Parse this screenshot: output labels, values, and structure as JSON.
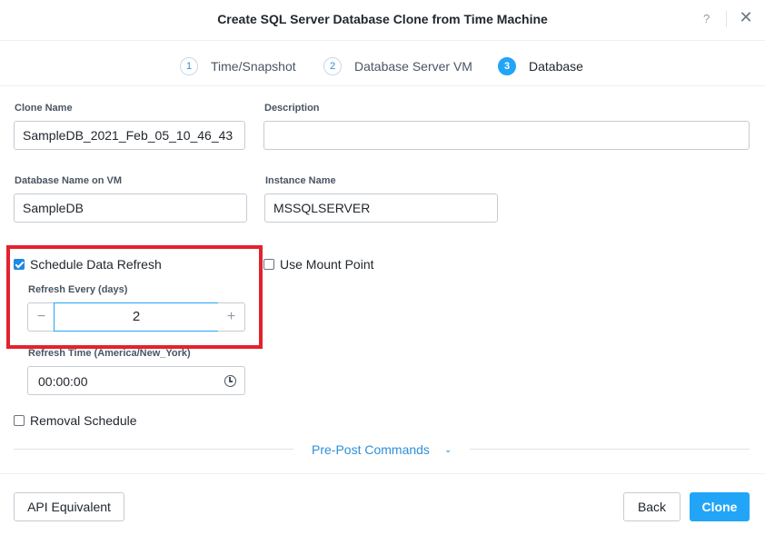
{
  "header": {
    "title": "Create SQL Server Database Clone from Time Machine",
    "help_label": "?",
    "close_label": "✕"
  },
  "wizard": {
    "steps": [
      {
        "number": "1",
        "label": "Time/Snapshot",
        "active": false
      },
      {
        "number": "2",
        "label": "Database Server VM",
        "active": false
      },
      {
        "number": "3",
        "label": "Database",
        "active": true
      }
    ]
  },
  "form": {
    "clone_name": {
      "label": "Clone Name",
      "value": "SampleDB_2021_Feb_05_10_46_43"
    },
    "description": {
      "label": "Description",
      "value": ""
    },
    "database_name": {
      "label": "Database Name on VM",
      "value": "SampleDB"
    },
    "instance_name": {
      "label": "Instance Name",
      "value": "MSSQLSERVER"
    },
    "schedule_refresh": {
      "label": "Schedule Data Refresh",
      "checked": true
    },
    "use_mount_point": {
      "label": "Use Mount Point",
      "checked": false
    },
    "refresh_every": {
      "label": "Refresh Every (days)",
      "value": "2",
      "minus": "−",
      "plus": "+"
    },
    "refresh_time": {
      "label": "Refresh Time (America/New_York)",
      "value": "00:00:00"
    },
    "removal_schedule": {
      "label": "Removal Schedule",
      "checked": false
    }
  },
  "prepost": {
    "label": "Pre-Post Commands",
    "chevron": "⌄"
  },
  "footer": {
    "api_label": "API Equivalent",
    "back_label": "Back",
    "clone_label": "Clone"
  },
  "colors": {
    "accent": "#22a5f7",
    "highlight": "#e3222d"
  },
  "icons": {
    "help": "help-icon",
    "close": "close-icon",
    "clock": "clock-icon",
    "chevron": "chevron-down-icon"
  }
}
